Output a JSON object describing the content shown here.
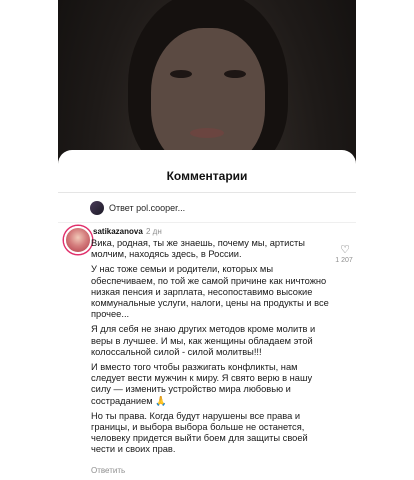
{
  "sheet": {
    "title": "Комментарии"
  },
  "reply_to": {
    "text": "Ответ pol.cooper..."
  },
  "comment": {
    "username": "satikazanova",
    "time": "2 дн",
    "paragraphs": [
      "Вика, родная, ты же знаешь, почему мы, артисты молчим, находясь здесь, в России.",
      "У нас тоже семьи и родители, которых мы обеспечиваем, по той же самой причине как ничтожно низкая пенсия и зарплата, несопоставимо высокие коммунальные услуги, налоги, цены на продукты и все прочее...",
      "Я для себя не знаю других методов кроме молитв и веры в лучшее. И мы, как женщины обладаем этой колоссальной силой - силой молитвы!!!",
      "И вместо того чтобы разжигать конфликты, нам следует вести мужчин к миру. Я свято верю в нашу силу — изменить устройство мира любовью и состраданием 🙏",
      "Но ты права. Когда будут нарушены все права и границы, и выбора выбора больше не останется, человеку придется выйти боем для защиты своей чести и своих прав."
    ],
    "like_icon": "heart-outline",
    "like_count": "1 207",
    "reply_label": "Ответить"
  }
}
